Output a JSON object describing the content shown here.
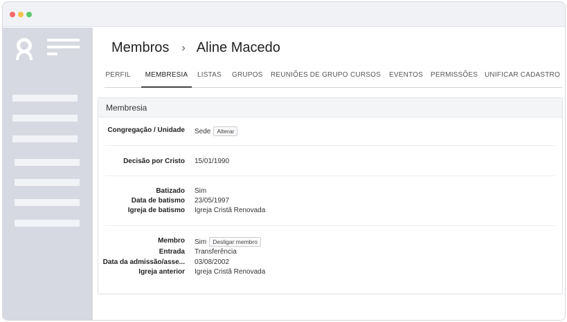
{
  "window": {
    "controls": [
      "close",
      "minimize",
      "maximize"
    ]
  },
  "sidebar": {
    "avatar_icon": "user-avatar-icon",
    "menu_icon": "hamburger-menu-icon"
  },
  "breadcrumb": {
    "parent": "Membros",
    "separator": "›",
    "current": "Aline Macedo"
  },
  "tabs": [
    {
      "label": "PERFIL"
    },
    {
      "label": "MEMBRESIA",
      "active": true
    },
    {
      "label": "LISTAS"
    },
    {
      "label": "GRUPOS"
    },
    {
      "label": "REUNIÕES DE GRUPO"
    },
    {
      "label": "CURSOS"
    },
    {
      "label": "EVENTOS"
    },
    {
      "label": "PERMISSÕES"
    },
    {
      "label": "UNIFICAR CADASTRO"
    }
  ],
  "panel": {
    "title": "Membresia",
    "congregacao": {
      "label": "Congregação / Unidade",
      "value": "Sede",
      "button": "Alterar"
    },
    "decisao": {
      "label": "Decisão por Cristo",
      "value": "15/01/1990"
    },
    "batizado": {
      "label": "Batizado",
      "value": "Sim"
    },
    "data_batismo": {
      "label": "Data de batismo",
      "value": "23/05/1997"
    },
    "igreja_batismo": {
      "label": "Igreja de batismo",
      "value": "Igreja Cristã Renovada"
    },
    "membro": {
      "label": "Membro",
      "value": "Sim",
      "button": "Desligar membro"
    },
    "entrada": {
      "label": "Entrada",
      "value": "Transferência"
    },
    "data_admissao": {
      "label": "Data da admissão/asse...",
      "value": "03/08/2002"
    },
    "igreja_anterior": {
      "label": "Igreja anterior",
      "value": "Igreja Cristã Renovada"
    }
  },
  "colors": {
    "sidebar_bg": "#d6d9e1",
    "titlebar_bg": "#f1f2f5",
    "dot_red": "#f46b6b",
    "dot_yellow": "#f6c34a",
    "dot_green": "#5dc76c"
  }
}
